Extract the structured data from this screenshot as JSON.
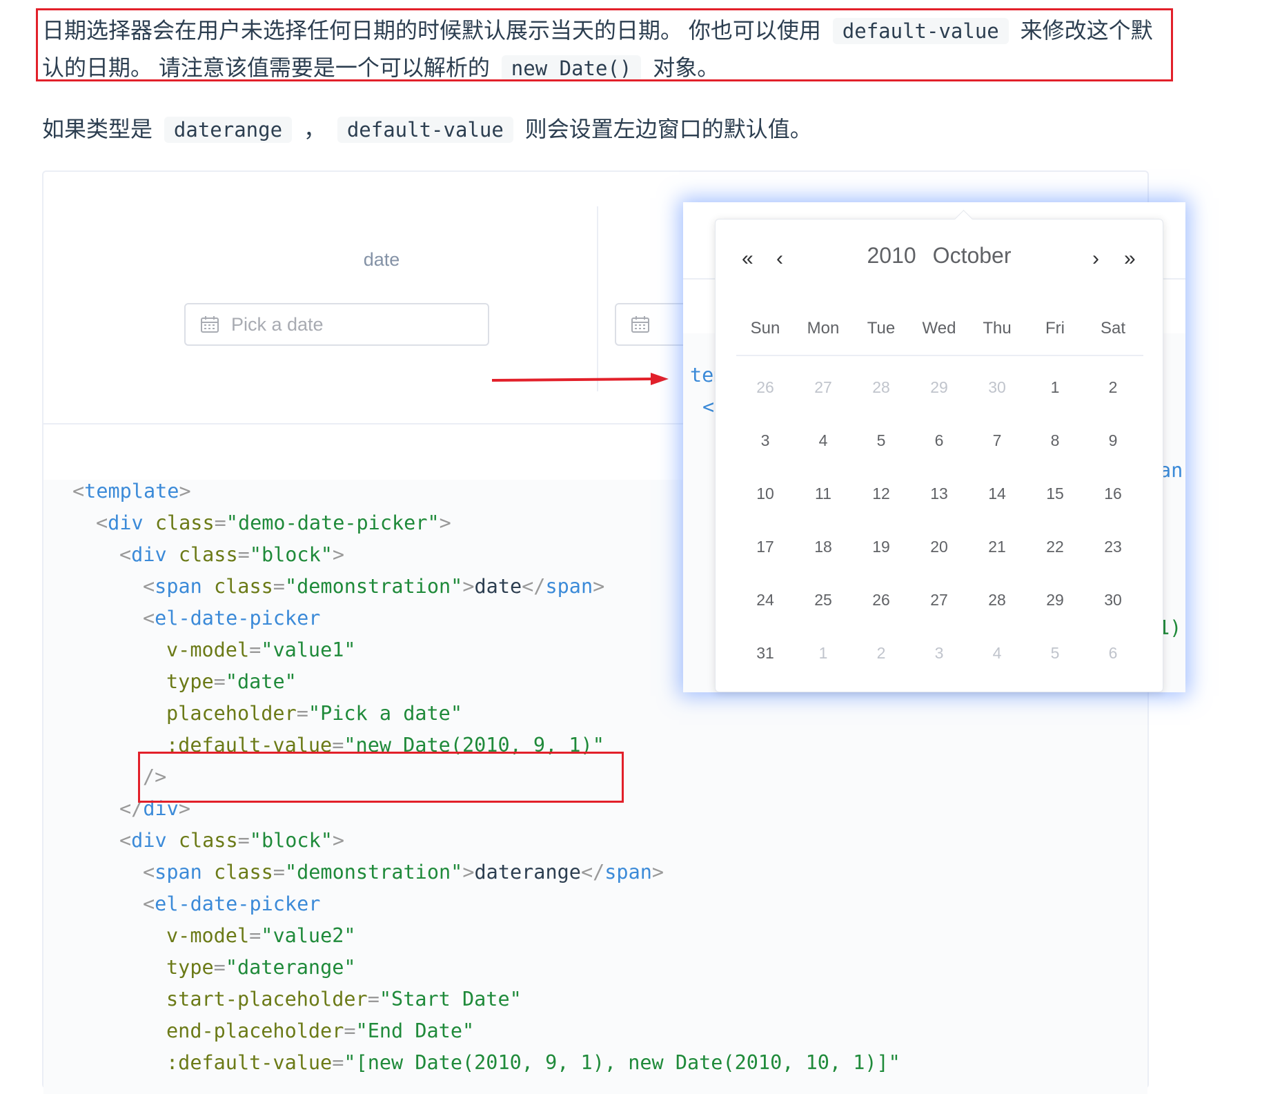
{
  "doc": {
    "p1_a": "日期选择器会在用户未选择任何日期的时候默认展示当天的日期。 你也可以使用",
    "p1_code1": "default-value",
    "p1_b": "来修改这个默认的日期。 请注意该值需要是一个可以解析的",
    "p1_code2": "new Date()",
    "p1_c": "对象。",
    "p2_a": "如果类型是",
    "p2_code1": "daterange",
    "p2_sep": "，",
    "p2_code2": "default-value",
    "p2_b": "则会设置左边窗口的默认值。"
  },
  "demo": {
    "label": "date",
    "placeholder": "Pick a date"
  },
  "code_frags": {
    "tem": "tem",
    "lt_c": "<c",
    "an": "an",
    "one_paren": "1)"
  },
  "code": {
    "l1_open": "<",
    "l1_tag": "template",
    "l1_close": ">",
    "l2_open": "<",
    "l2_tag": "div",
    "l2_attr": " class",
    "l2_eq": "=",
    "l2_val": "\"demo-date-picker\"",
    "l2_close": ">",
    "l3_open": "<",
    "l3_tag": "div",
    "l3_attr": " class",
    "l3_eq": "=",
    "l3_val": "\"block\"",
    "l3_close": ">",
    "l4_open": "<",
    "l4_tag": "span",
    "l4_attr": " class",
    "l4_eq": "=",
    "l4_val": "\"demonstration\"",
    "l4_gt": ">",
    "l4_text": "date",
    "l4_end_open": "</",
    "l4_end_tag": "span",
    "l4_end_close": ">",
    "l5_open": "<",
    "l5_tag": "el-date-picker",
    "l6_attr": "v-model",
    "l6_eq": "=",
    "l6_val": "\"value1\"",
    "l7_attr": "type",
    "l7_eq": "=",
    "l7_val": "\"date\"",
    "l8_attr": "placeholder",
    "l8_eq": "=",
    "l8_val": "\"Pick a date\"",
    "l9_attr": ":default-value",
    "l9_eq": "=",
    "l9_val": "\"new Date(2010, 9, 1)\"",
    "l10": "/>",
    "l11_open": "</",
    "l11_tag": "div",
    "l11_close": ">",
    "l12_open": "<",
    "l12_tag": "div",
    "l12_attr": " class",
    "l12_eq": "=",
    "l12_val": "\"block\"",
    "l12_close": ">",
    "l13_open": "<",
    "l13_tag": "span",
    "l13_attr": " class",
    "l13_eq": "=",
    "l13_val": "\"demonstration\"",
    "l13_gt": ">",
    "l13_text": "daterange",
    "l13_end_open": "</",
    "l13_end_tag": "span",
    "l13_end_close": ">",
    "l14_open": "<",
    "l14_tag": "el-date-picker",
    "l15_attr": "v-model",
    "l15_eq": "=",
    "l15_val": "\"value2\"",
    "l16_attr": "type",
    "l16_eq": "=",
    "l16_val": "\"daterange\"",
    "l17_attr": "start-placeholder",
    "l17_eq": "=",
    "l17_val": "\"Start Date\"",
    "l18_attr": "end-placeholder",
    "l18_eq": "=",
    "l18_val": "\"End Date\"",
    "l19_attr": ":default-value",
    "l19_eq": "=",
    "l19_val": "\"[new Date(2010, 9, 1), new Date(2010, 10, 1)]\""
  },
  "picker": {
    "year": "2010",
    "month": "October",
    "prev_year": "«",
    "prev_month": "‹",
    "next_month": "›",
    "next_year": "»",
    "weekdays": [
      "Sun",
      "Mon",
      "Tue",
      "Wed",
      "Thu",
      "Fri",
      "Sat"
    ],
    "weeks": [
      [
        "26",
        "27",
        "28",
        "29",
        "30",
        "1",
        "2"
      ],
      [
        "3",
        "4",
        "5",
        "6",
        "7",
        "8",
        "9"
      ],
      [
        "10",
        "11",
        "12",
        "13",
        "14",
        "15",
        "16"
      ],
      [
        "17",
        "18",
        "19",
        "20",
        "21",
        "22",
        "23"
      ],
      [
        "24",
        "25",
        "26",
        "27",
        "28",
        "29",
        "30"
      ],
      [
        "31",
        "1",
        "2",
        "3",
        "4",
        "5",
        "6"
      ]
    ],
    "muted": [
      [
        true,
        true,
        true,
        true,
        true,
        false,
        false
      ],
      [
        false,
        false,
        false,
        false,
        false,
        false,
        false
      ],
      [
        false,
        false,
        false,
        false,
        false,
        false,
        false
      ],
      [
        false,
        false,
        false,
        false,
        false,
        false,
        false
      ],
      [
        false,
        false,
        false,
        false,
        false,
        false,
        false
      ],
      [
        false,
        true,
        true,
        true,
        true,
        true,
        true
      ]
    ]
  },
  "colors": {
    "highlight_box": "#e2202a",
    "arrow": "#e2202a",
    "overlay_glow": "#5a8cff"
  }
}
